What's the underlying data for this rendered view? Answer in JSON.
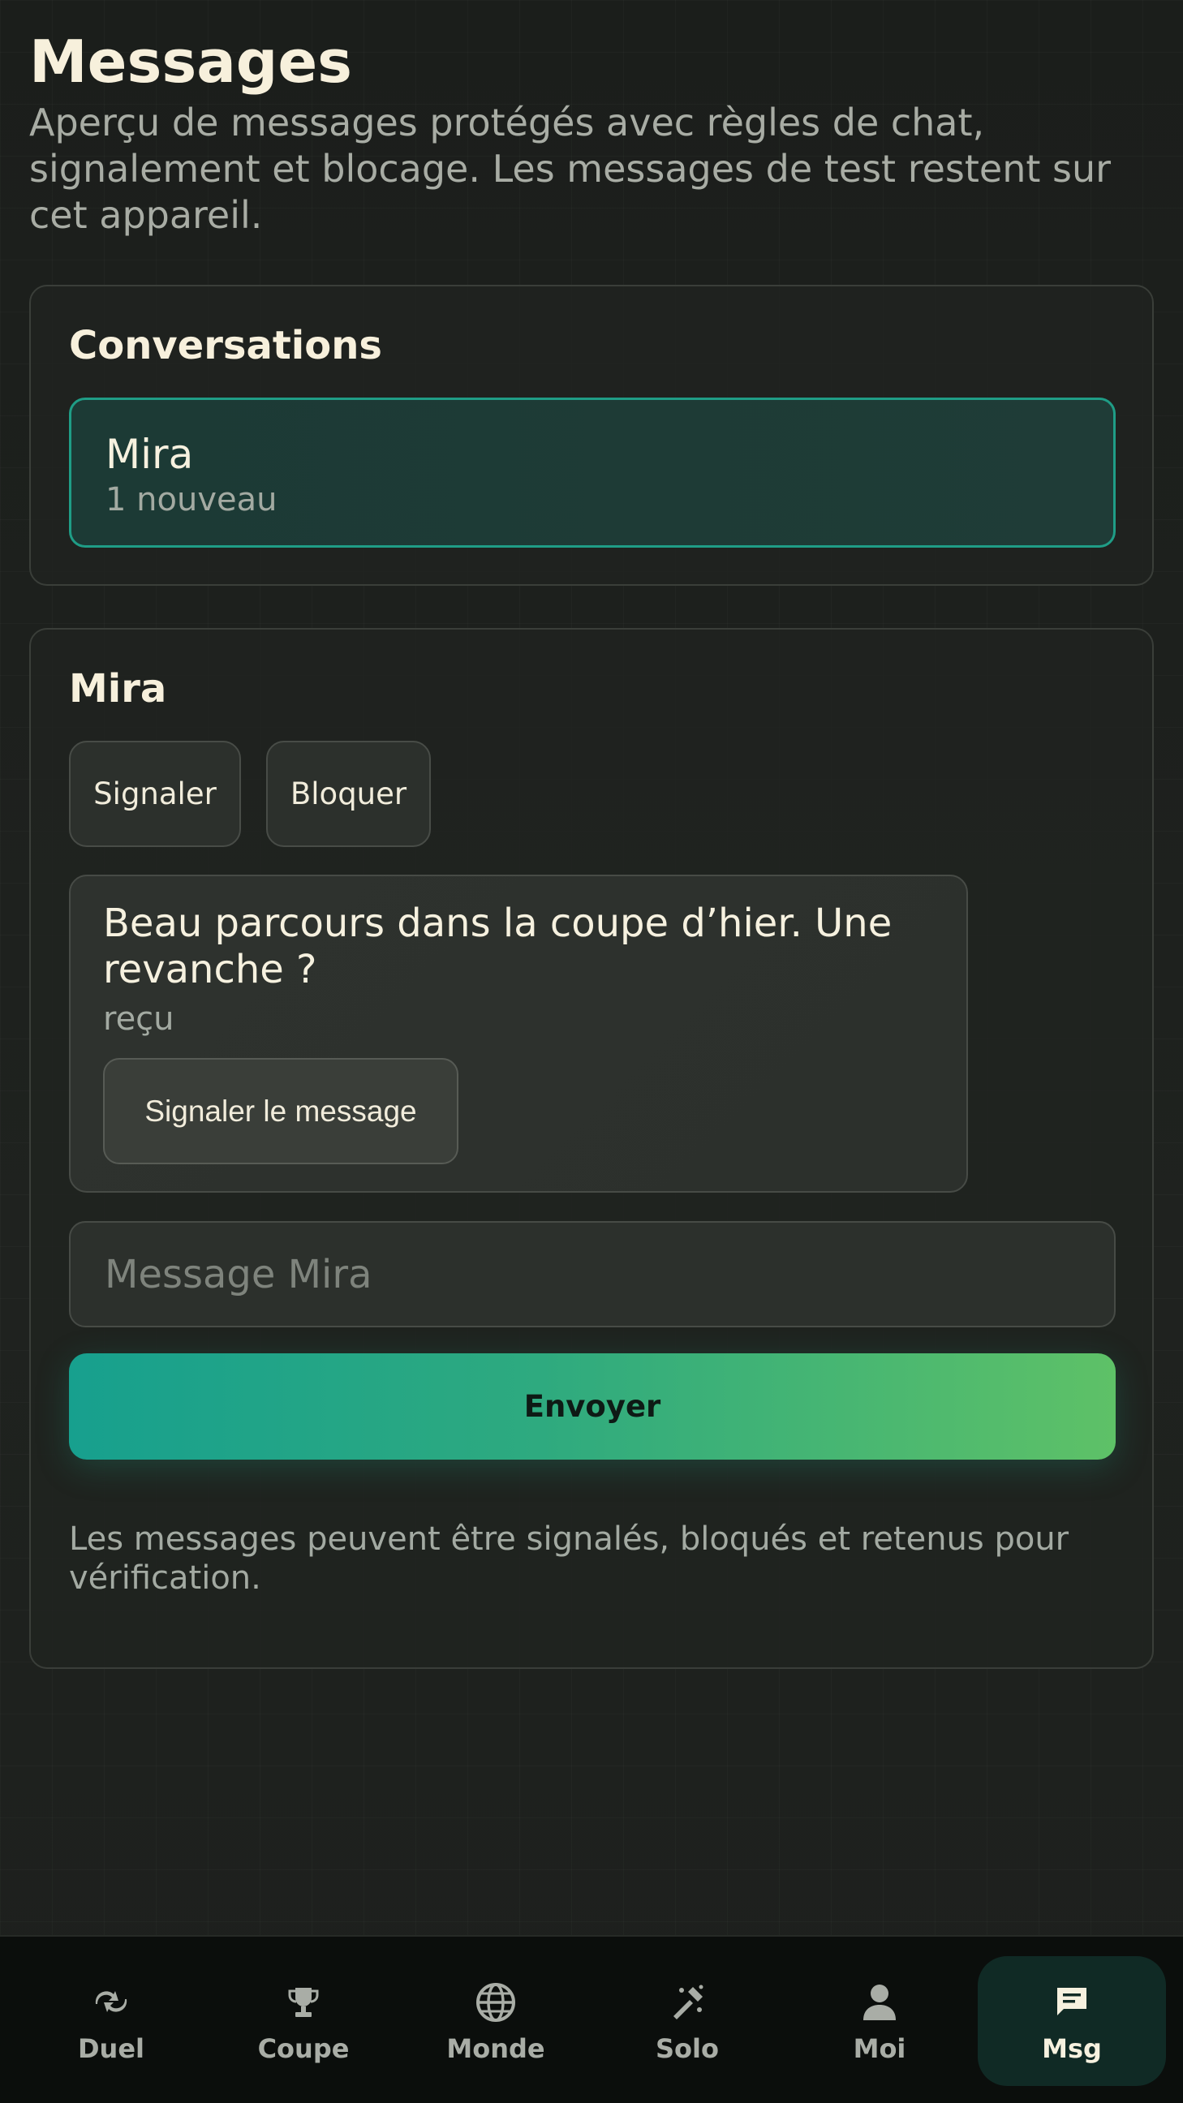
{
  "header": {
    "title": "Messages",
    "subtitle": "Aperçu de messages protégés avec règles de chat, signalement et blocage. Les messages de test restent sur cet appareil."
  },
  "conversations": {
    "title": "Conversations",
    "items": [
      {
        "name": "Mira",
        "meta": "1 nouveau"
      }
    ]
  },
  "chat": {
    "title": "Mira",
    "report_label": "Signaler",
    "block_label": "Bloquer",
    "messages": [
      {
        "text": "Beau parcours dans la coupe d’hier. Une revanche ?",
        "status": "reçu",
        "report_label": "Signaler le message"
      }
    ],
    "input_placeholder": "Message Mira",
    "input_value": "",
    "send_label": "Envoyer",
    "notice": "Les messages peuvent être signalés, bloqués et retenus pour vérification."
  },
  "tabs": [
    {
      "label": "Duel",
      "icon": "duel-icon"
    },
    {
      "label": "Coupe",
      "icon": "trophy-icon"
    },
    {
      "label": "Monde",
      "icon": "globe-icon"
    },
    {
      "label": "Solo",
      "icon": "solo-icon"
    },
    {
      "label": "Moi",
      "icon": "person-icon"
    },
    {
      "label": "Msg",
      "icon": "message-icon",
      "active": true
    }
  ],
  "colors": {
    "accent": "#1f9d86",
    "send_gradient_start": "#17a08e",
    "send_gradient_end": "#5ec167",
    "background": "#1c1f1c",
    "tabbar": "#0b0e0c"
  }
}
